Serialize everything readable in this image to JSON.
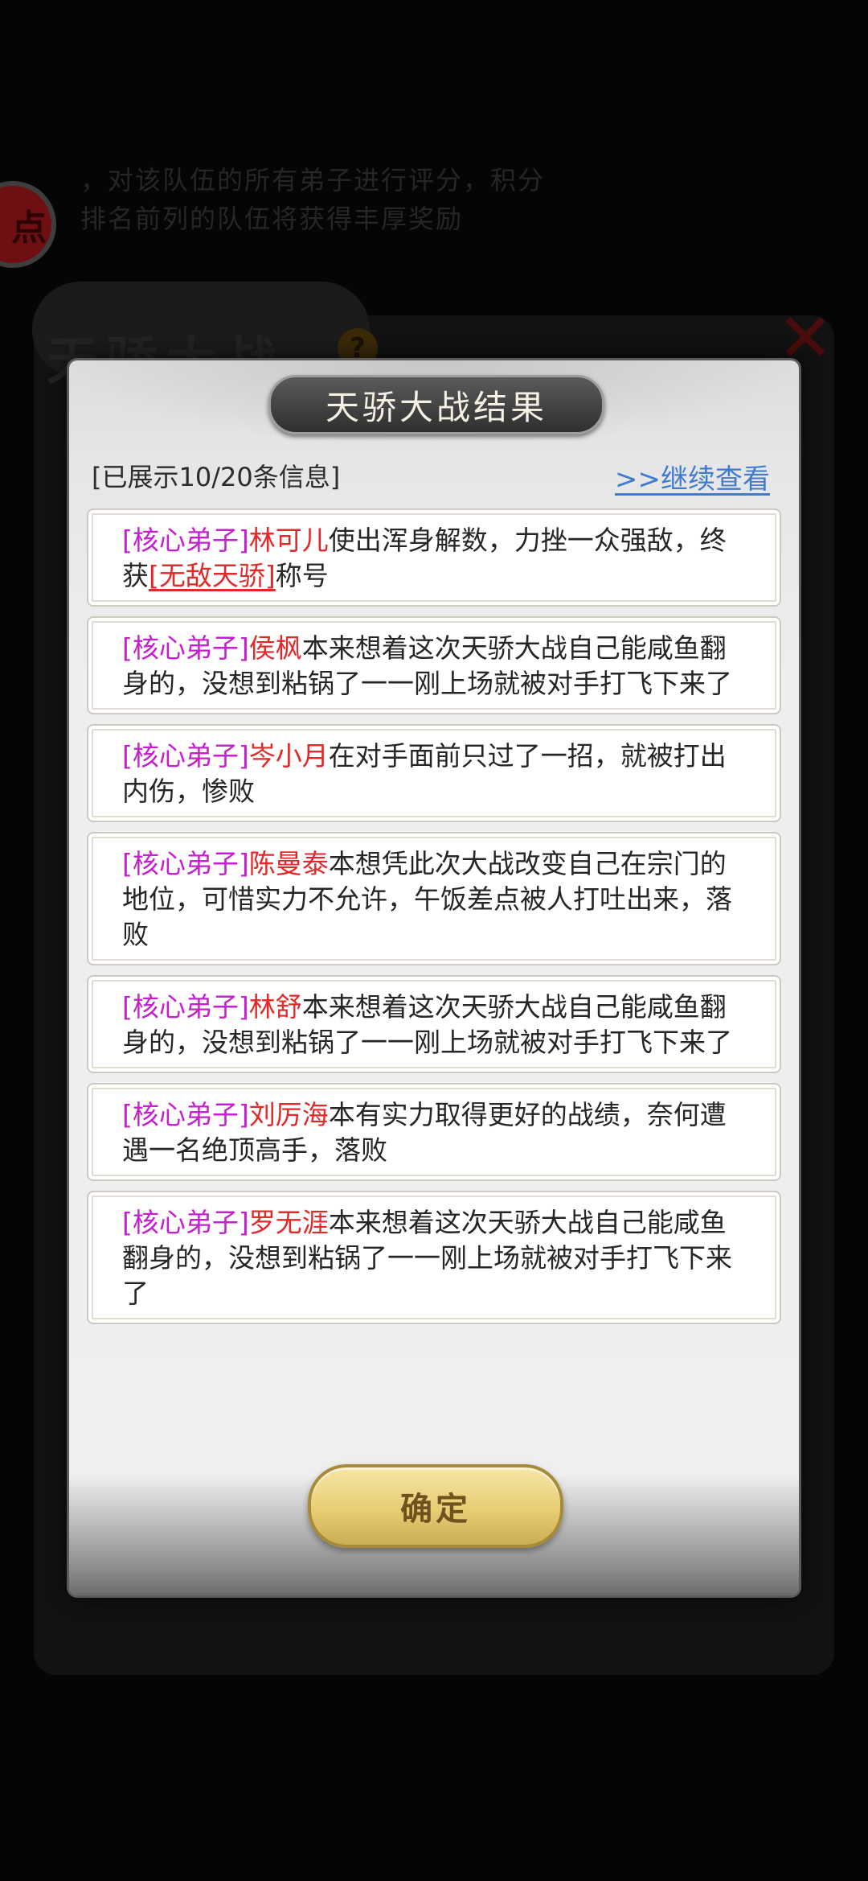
{
  "background": {
    "text_lines": [
      "，对该队伍的所有弟子进行评分，积分",
      "排名前列的队伍将获得丰厚奖励"
    ],
    "side_button_label": "点",
    "panel_title": "天骄大战",
    "help_icon_glyph": "?",
    "close_icon_glyph": "✕"
  },
  "dialog": {
    "title": "天骄大战结果",
    "shown_info": "[已展示10/20条信息]",
    "view_more_label": ">>继续查看",
    "confirm_label": "确定",
    "entries": [
      {
        "tag": "[核心弟子]",
        "name": "林可儿",
        "text": "使出浑身解数，力挫一众强敌，终获",
        "honor": "[无敌天骄]",
        "suffix": "称号"
      },
      {
        "tag": "[核心弟子]",
        "name": "侯枫",
        "text": "本来想着这次天骄大战自己能咸鱼翻身的，没想到粘锅了一一刚上场就被对手打飞下来了"
      },
      {
        "tag": "[核心弟子]",
        "name": "岑小月",
        "text": "在对手面前只过了一招，就被打出内伤，惨败"
      },
      {
        "tag": "[核心弟子]",
        "name": "陈曼泰",
        "text": "本想凭此次大战改变自己在宗门的地位，可惜实力不允许，午饭差点被人打吐出来，落败"
      },
      {
        "tag": "[核心弟子]",
        "name": "林舒",
        "text": "本来想着这次天骄大战自己能咸鱼翻身的，没想到粘锅了一一刚上场就被对手打飞下来了"
      },
      {
        "tag": "[核心弟子]",
        "name": "刘厉海",
        "text": "本有实力取得更好的战绩，奈何遭遇一名绝顶高手，落败"
      },
      {
        "tag": "[核心弟子]",
        "name": "罗无涯",
        "text": "本来想着这次天骄大战自己能咸鱼翻身的，没想到粘锅了一一刚上场就被对手打飞下来了"
      }
    ]
  },
  "colors": {
    "tag": "#c61fcf",
    "name": "#e42727",
    "link": "#3f7bd0",
    "button_gold": "#e7cd74"
  }
}
